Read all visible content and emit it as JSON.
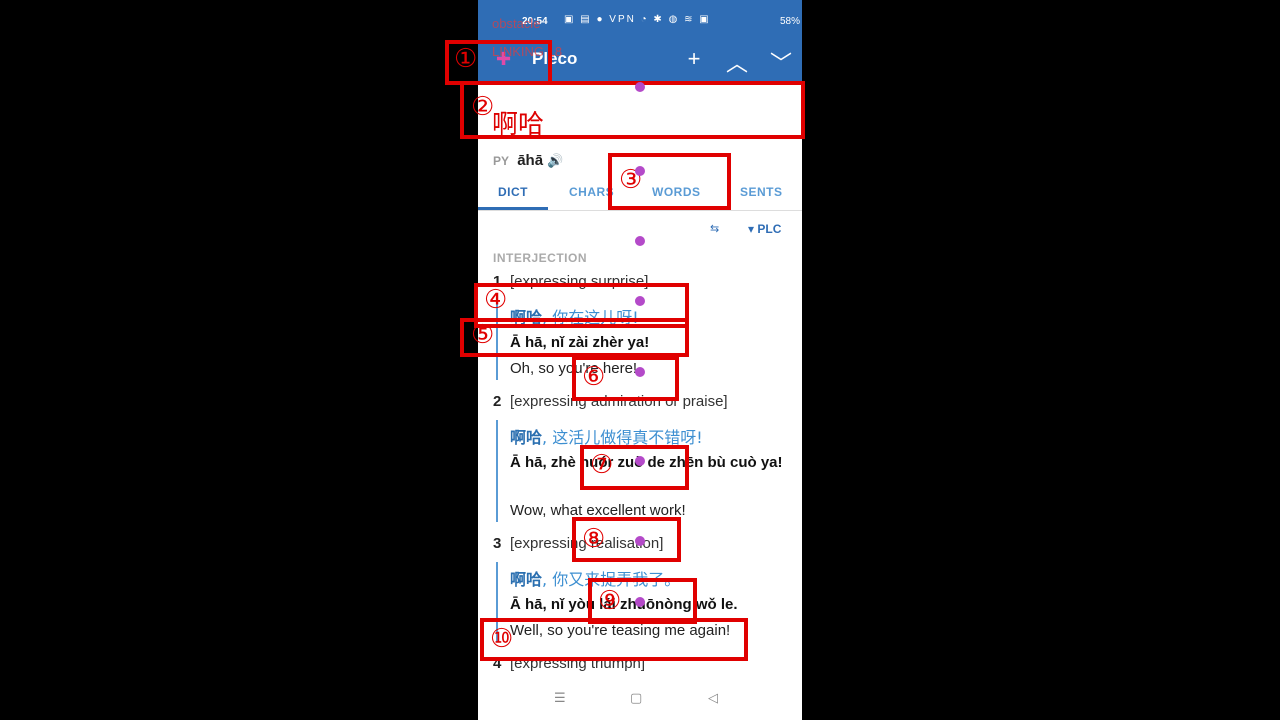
{
  "status": {
    "time": "20:54",
    "icons": "▣ ▤ ● VPN ◔ ✱ ◍ ≋ ▣",
    "battery": "58%"
  },
  "appbar": {
    "logo": "✚",
    "title": "Pleco",
    "add": "+",
    "up": "︿",
    "down": "﹀"
  },
  "entry": {
    "headword": "啊哈",
    "py_label": "PY",
    "pinyin": "āhā",
    "speaker": "🔊"
  },
  "tabs": [
    "DICT",
    "CHARS",
    "WORDS",
    "SENTS"
  ],
  "dict": {
    "source": "PLC",
    "source_arrow": "▾",
    "filter_icon": "⇆"
  },
  "pos": "INTERJECTION",
  "senses": [
    {
      "num": "1",
      "gloss": "[expressing surprise]",
      "cn_head": "啊哈",
      "cn_rest": ", 你在这儿呀!",
      "py": "Ā hā, nǐ zài zhèr ya!",
      "en": "Oh, so you're here!"
    },
    {
      "num": "2",
      "gloss": "[expressing admiration or praise]",
      "cn_head": "啊哈",
      "cn_rest": ", 这活儿做得真不错呀!",
      "py": "Ā hā, zhè huór zuò de zhēn bù cuò ya!",
      "en": "Wow, what excellent work!"
    },
    {
      "num": "3",
      "gloss": "[expressing realisation]",
      "cn_head": "啊哈",
      "cn_rest": ", 你又来捉弄我了。",
      "py": "Ā hā, nǐ yòu lái zhuōnòng wǒ le.",
      "en": "Well, so you're teasing me again!"
    },
    {
      "num": "4",
      "gloss": "[expressing triumph]"
    }
  ],
  "navbar": {
    "menu": "☰",
    "home": "▢",
    "back": "◁"
  },
  "annotations": [
    "①",
    "②",
    "③",
    "④",
    "⑤",
    "⑥",
    "⑦",
    "⑧",
    "⑨",
    "⑩"
  ],
  "ghost": {
    "line1": "obstacle",
    "line2": "LINKING 18"
  },
  "colors": {
    "accent": "#2f6db5",
    "annotation": "#e00000",
    "headword": "#dd0000"
  }
}
